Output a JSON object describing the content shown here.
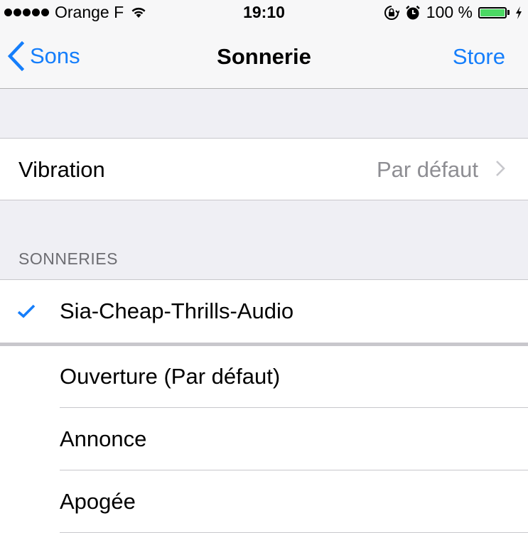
{
  "status_bar": {
    "signal_dots": 5,
    "carrier": "Orange F",
    "time": "19:10",
    "battery_percent": "100 %",
    "battery_level": 1.0,
    "icons": [
      "signal-dots-icon",
      "wifi-icon",
      "rotation-lock-icon",
      "alarm-icon",
      "battery-icon",
      "charging-bolt-icon"
    ],
    "battery_color": "#4cd964"
  },
  "nav": {
    "back_label": "Sons",
    "title": "Sonnerie",
    "right_label": "Store",
    "accent_color": "#157efb"
  },
  "vibration": {
    "label": "Vibration",
    "value": "Par défaut"
  },
  "ringtones": {
    "section_header": "SONNERIES",
    "items": [
      {
        "label": "Sia-Cheap-Thrills-Audio",
        "selected": true
      },
      {
        "label": "Ouverture (Par défaut)",
        "selected": false
      },
      {
        "label": "Annonce",
        "selected": false
      },
      {
        "label": "Apogée",
        "selected": false
      }
    ]
  }
}
